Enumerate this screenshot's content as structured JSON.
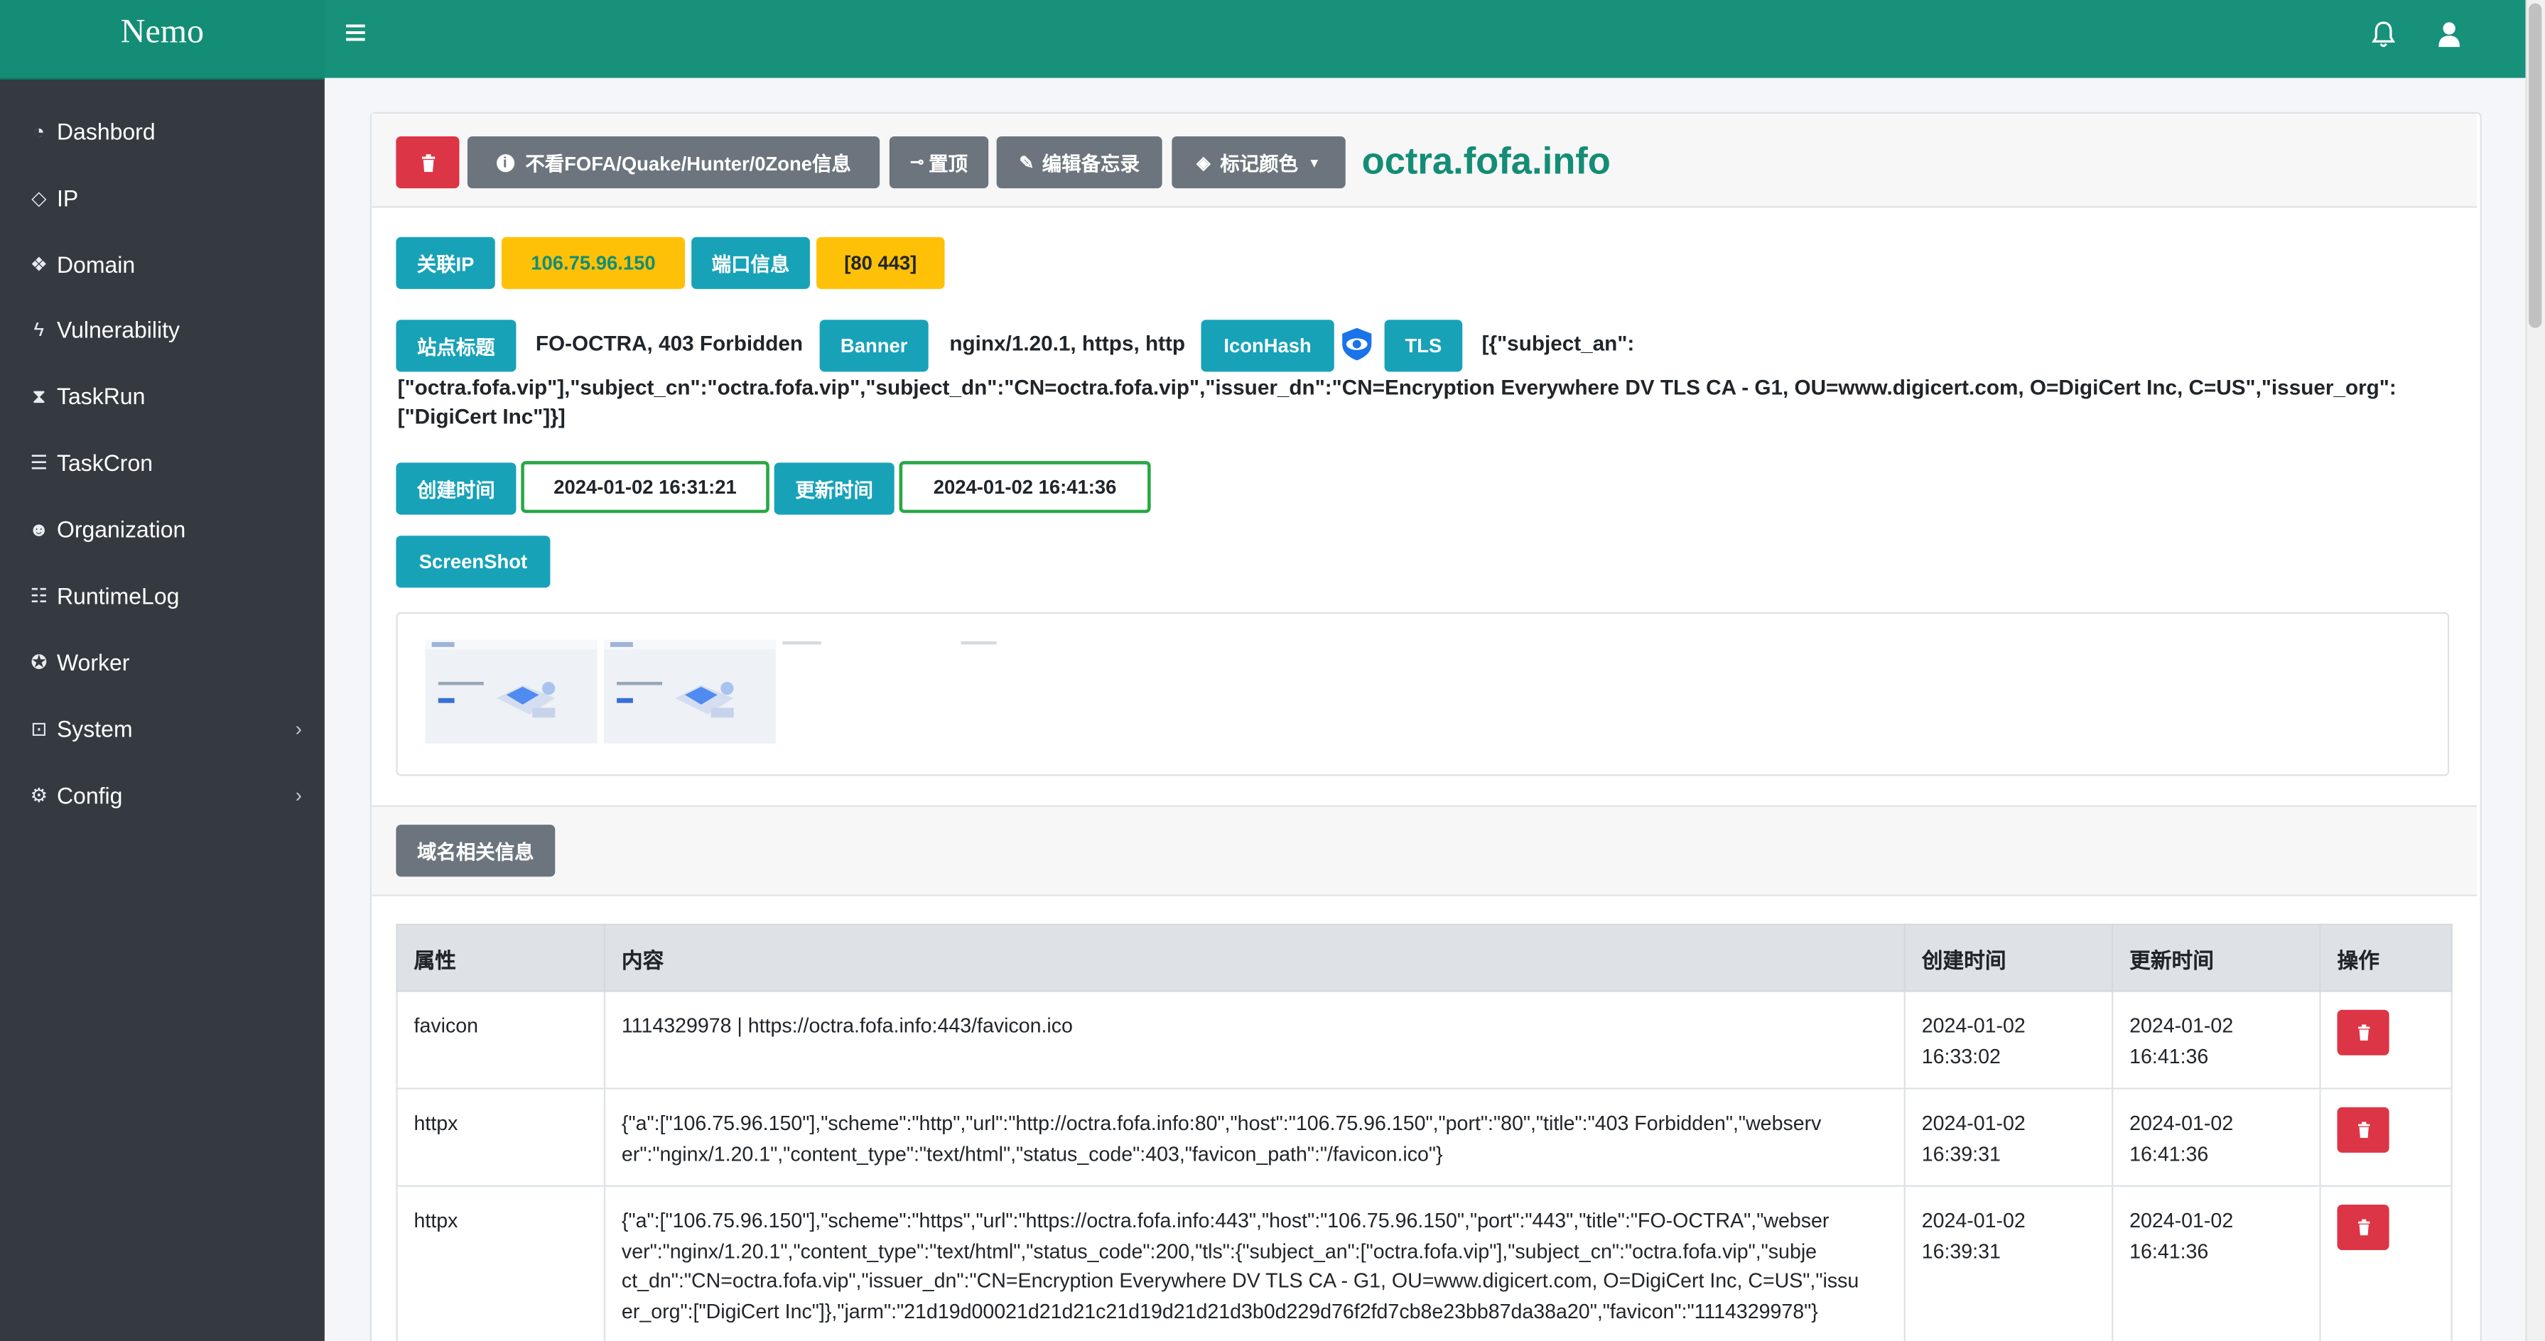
{
  "brand": "Nemo",
  "sidebar": {
    "items": [
      {
        "label": "Dashbord",
        "icon": "dashboard-icon",
        "glyph": "◔"
      },
      {
        "label": "IP",
        "icon": "ip-icon",
        "glyph": "◇"
      },
      {
        "label": "Domain",
        "icon": "domain-icon",
        "glyph": "❖"
      },
      {
        "label": "Vulnerability",
        "icon": "bolt-icon",
        "glyph": "ϟ"
      },
      {
        "label": "TaskRun",
        "icon": "hourglass-icon",
        "glyph": "⧗"
      },
      {
        "label": "TaskCron",
        "icon": "server-icon",
        "glyph": "☰"
      },
      {
        "label": "Organization",
        "icon": "users-icon",
        "glyph": "☻"
      },
      {
        "label": "RuntimeLog",
        "icon": "sliders-icon",
        "glyph": "☷"
      },
      {
        "label": "Worker",
        "icon": "worker-icon",
        "glyph": "✪"
      },
      {
        "label": "System",
        "icon": "lock-icon",
        "glyph": "⊡",
        "chevron": "›"
      },
      {
        "label": "Config",
        "icon": "cogs-icon",
        "glyph": "⚙",
        "chevron": "›"
      }
    ]
  },
  "header": {
    "menu_icon": "≡",
    "bell_icon": "bell-icon",
    "user_icon": "user-icon"
  },
  "toolbar": {
    "hide_label": "不看FOFA/Quake/Hunter/0Zone信息",
    "pin_label": "置顶",
    "memo_label": "编辑备忘录",
    "color_label": "标记颜色",
    "domain": "octra.fofa.info"
  },
  "info": {
    "related_ip_label": "关联IP",
    "related_ip_value": "106.75.96.150",
    "port_label": "端口信息",
    "port_value": "[80 443]",
    "title_label": "站点标题",
    "title_value": "FO-OCTRA, 403 Forbidden",
    "banner_label": "Banner",
    "banner_value": "nginx/1.20.1, https, http",
    "iconhash_label": "IconHash",
    "tls_label": "TLS",
    "tls_line1": "[{\"subject_an\":",
    "tls_line2": "[\"octra.fofa.vip\"],\"subject_cn\":\"octra.fofa.vip\",\"subject_dn\":\"CN=octra.fofa.vip\",\"issuer_dn\":\"CN=Encryption Everywhere DV TLS CA - G1, OU=www.digicert.com, O=DigiCert Inc, C=US\",\"issuer_org\":",
    "tls_line3": "[\"DigiCert Inc\"]}]",
    "created_label": "创建时间",
    "created_value": "2024-01-02 16:31:21",
    "updated_label": "更新时间",
    "updated_value": "2024-01-02 16:41:36",
    "screenshot_label": "ScreenShot"
  },
  "section": {
    "domain_info_label": "域名相关信息"
  },
  "table": {
    "headers": [
      "属性",
      "内容",
      "创建时间",
      "更新时间",
      "操作"
    ],
    "rows": [
      {
        "attr": "favicon",
        "content": [
          "1114329978 | https://octra.fofa.info:443/favicon.ico"
        ],
        "created": [
          "2024-01-02",
          "16:33:02"
        ],
        "updated": [
          "2024-01-02",
          "16:41:36"
        ]
      },
      {
        "attr": "httpx",
        "content": [
          "{\"a\":[\"106.75.96.150\"],\"scheme\":\"http\",\"url\":\"http://octra.fofa.info:80\",\"host\":\"106.75.96.150\",\"port\":\"80\",\"title\":\"403 Forbidden\",\"webserv",
          "er\":\"nginx/1.20.1\",\"content_type\":\"text/html\",\"status_code\":403,\"favicon_path\":\"/favicon.ico\"}"
        ],
        "created": [
          "2024-01-02",
          "16:39:31"
        ],
        "updated": [
          "2024-01-02",
          "16:41:36"
        ]
      },
      {
        "attr": "httpx",
        "content": [
          "{\"a\":[\"106.75.96.150\"],\"scheme\":\"https\",\"url\":\"https://octra.fofa.info:443\",\"host\":\"106.75.96.150\",\"port\":\"443\",\"title\":\"FO-OCTRA\",\"webser",
          "ver\":\"nginx/1.20.1\",\"content_type\":\"text/html\",\"status_code\":200,\"tls\":{\"subject_an\":[\"octra.fofa.vip\"],\"subject_cn\":\"octra.fofa.vip\",\"subje",
          "ct_dn\":\"CN=octra.fofa.vip\",\"issuer_dn\":\"CN=Encryption Everywhere DV TLS CA - G1, OU=www.digicert.com, O=DigiCert Inc, C=US\",\"issu",
          "er_org\":[\"DigiCert Inc\"]},\"jarm\":\"21d19d00021d21d21c21d19d21d21d3b0d229d76f2fd7cb8e23bb87da38a20\",\"favicon\":\"1114329978\"}"
        ],
        "created": [
          "2024-01-02",
          "16:39:31"
        ],
        "updated": [
          "2024-01-02",
          "16:41:36"
        ]
      }
    ]
  },
  "colors": {
    "sidebar": "#343a40",
    "brand": "#138d75",
    "topbar": "#17917a",
    "info": "#17a2b8",
    "warning": "#ffc107",
    "danger": "#dc3545",
    "secondary": "#6c757d",
    "success": "#28a745"
  }
}
